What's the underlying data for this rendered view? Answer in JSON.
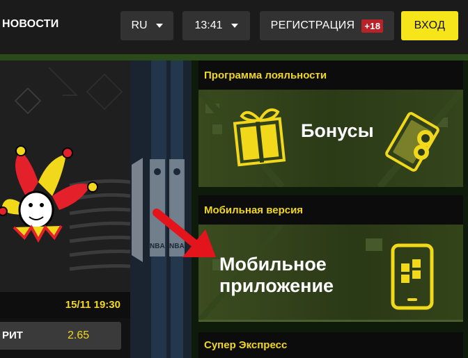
{
  "header": {
    "news_label": "НОВОСТИ",
    "lang": "RU",
    "time": "13:41",
    "register_label": "РЕГИСТРАЦИЯ",
    "age_badge": "+18",
    "login_label": "ВХОД"
  },
  "match": {
    "datetime": "15/11 19:30",
    "outcome_label": "РИТ",
    "odds": "2.65"
  },
  "promos": [
    {
      "heading": "Программа лояльности",
      "banner_text": "Бонусы"
    },
    {
      "heading": "Мобильная версия",
      "banner_line1": "Мобильное",
      "banner_line2": "приложение"
    },
    {
      "heading": "Супер Экспресс"
    }
  ],
  "colors": {
    "accent_yellow": "#f7e51b",
    "badge_red": "#b8232a",
    "arrow_red": "#e3141b"
  },
  "icons": [
    "gift-icon",
    "money-icon",
    "phone-icon",
    "jester-logo",
    "nba-logo",
    "red-arrow"
  ]
}
